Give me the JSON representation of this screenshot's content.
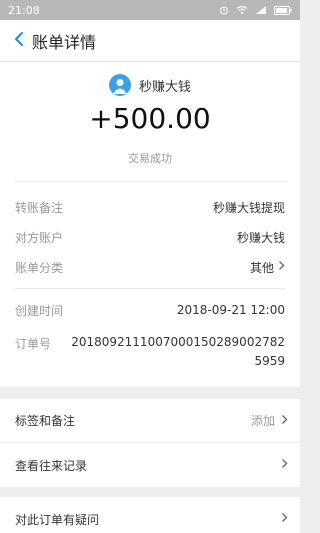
{
  "status_bar": {
    "time": "21:08"
  },
  "nav": {
    "title": "账单详情"
  },
  "header": {
    "merchant": "秒赚大钱",
    "amount": "+500.00",
    "status": "交易成功"
  },
  "details": [
    {
      "label": "转账备注",
      "value": "秒赚大钱提现"
    },
    {
      "label": "对方账户",
      "value": "秒赚大钱"
    },
    {
      "label": "账单分类",
      "value": "其他"
    }
  ],
  "info": {
    "created_label": "创建时间",
    "created_value": "2018-09-21 12:00",
    "order_label": "订单号",
    "order_value": "2018092111007000150289002782 5959"
  },
  "actions": [
    {
      "label": "标签和备注",
      "hint": "添加"
    },
    {
      "label": "查看往来记录",
      "hint": ""
    }
  ],
  "question": {
    "label": "对此订单有疑问"
  },
  "colors": {
    "accent": "#1a8be8",
    "status_bar": "#b8b8b8",
    "avatar": "#3aa0ea"
  }
}
